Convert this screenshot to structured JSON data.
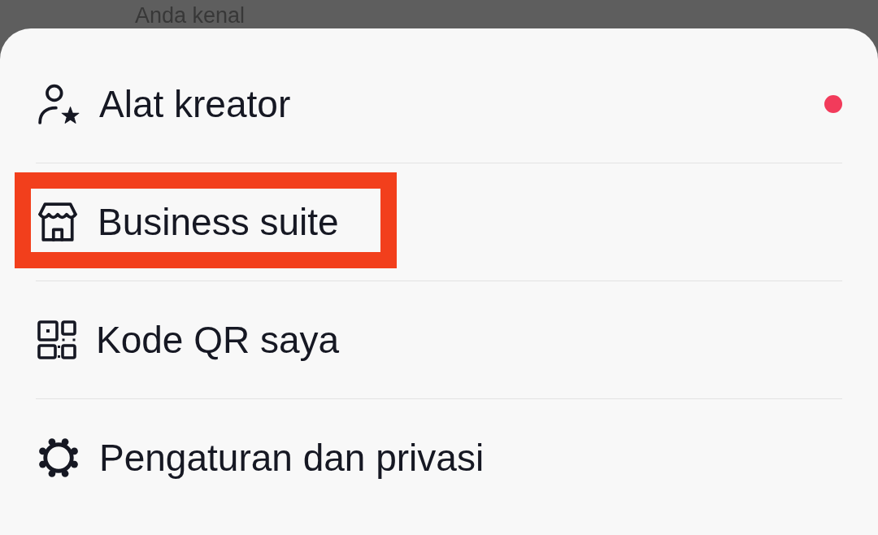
{
  "background": {
    "text": "Anda kenal"
  },
  "menu": {
    "items": [
      {
        "kind": "creator",
        "label": "Alat kreator",
        "notification_dot": true,
        "highlighted": false
      },
      {
        "kind": "business",
        "label": "Business suite",
        "notification_dot": false,
        "highlighted": true
      },
      {
        "kind": "qr",
        "label": "Kode QR saya",
        "notification_dot": false,
        "highlighted": false
      },
      {
        "kind": "settings",
        "label": "Pengaturan dan privasi",
        "notification_dot": false,
        "highlighted": false
      }
    ]
  }
}
